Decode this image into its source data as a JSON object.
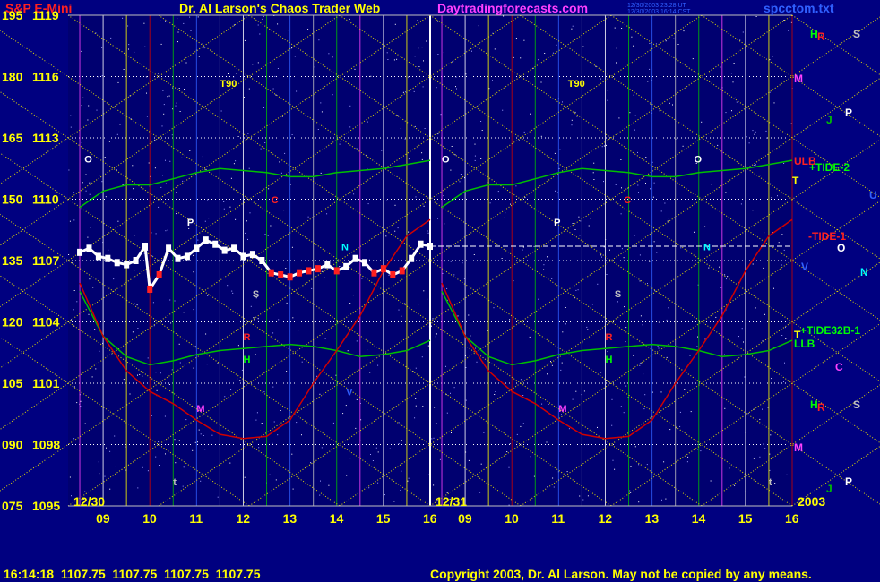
{
  "header": {
    "symbol": "S&P E-Mini",
    "title": "Dr. Al Larson's Chaos Trader Web",
    "site": "Daytradingforecasts.com",
    "stamp_line1": "12/30/2003 23:28 UT",
    "stamp_line2": "12/30/2003 16:14 CST",
    "file": "spcctom.txt"
  },
  "footer": {
    "quote": "16:14:18  1107.75  1107.75  1107.75  1107.75",
    "copyright": "Copyright 2003, Dr. Al Larson. May not be copied by any means."
  },
  "colors": {
    "background": "#000080",
    "plot_background": "#000070",
    "price_text": "#ffff00",
    "symbol_red": "#ff2020",
    "site_magenta": "#ff40ff",
    "file_blue": "#3060ff",
    "grid_yellow": "#e8e000",
    "tide_green": "#00c000",
    "tide_red": "#d00000"
  },
  "chart_data": {
    "type": "line",
    "title": "S&P E-Mini",
    "y_left_labels": [
      "195",
      "180",
      "165",
      "150",
      "135",
      "120",
      "105",
      "090",
      "075"
    ],
    "y_price_labels": [
      "1119",
      "1116",
      "1113",
      "1110",
      "1107",
      "1104",
      "1101",
      "1098",
      "1095"
    ],
    "ylim": [
      1095,
      1119
    ],
    "panels": [
      {
        "date_label": "12/30",
        "hours": [
          "09",
          "10",
          "11",
          "12",
          "13",
          "14",
          "15",
          "16"
        ]
      },
      {
        "date_label": "12/31",
        "hours": [
          "09",
          "10",
          "11",
          "12",
          "13",
          "14",
          "15",
          "16"
        ]
      }
    ],
    "year_label": "2003",
    "price_series": {
      "name": "price",
      "x_hours": [
        8.5,
        8.7,
        8.9,
        9.1,
        9.3,
        9.5,
        9.7,
        9.9,
        10.0,
        10.2,
        10.4,
        10.6,
        10.8,
        11.0,
        11.2,
        11.4,
        11.6,
        11.8,
        12.0,
        12.2,
        12.4,
        12.6,
        12.8,
        13.0,
        13.2,
        13.4,
        13.6,
        13.8,
        14.0,
        14.2,
        14.4,
        14.6,
        14.8,
        15.0,
        15.2,
        15.4,
        15.6,
        15.8,
        16.0
      ],
      "y": [
        1107.4,
        1107.6,
        1107.2,
        1107.1,
        1106.9,
        1106.8,
        1107.0,
        1107.7,
        1105.6,
        1106.3,
        1107.6,
        1107.1,
        1107.2,
        1107.6,
        1108.0,
        1107.8,
        1107.5,
        1107.6,
        1107.2,
        1107.3,
        1107.0,
        1106.4,
        1106.3,
        1106.2,
        1106.4,
        1106.5,
        1106.6,
        1106.8,
        1106.5,
        1106.7,
        1107.1,
        1106.9,
        1106.4,
        1106.6,
        1106.3,
        1106.5,
        1107.1,
        1107.8,
        1107.7
      ]
    },
    "tides": [
      {
        "name": "TIDE-2",
        "x_hours": [
          8.5,
          9.0,
          9.5,
          10.0,
          10.5,
          11.0,
          11.5,
          12.0,
          12.5,
          13.0,
          13.5,
          14.0,
          14.5,
          15.0,
          15.5,
          16.0
        ],
        "y": [
          1109.6,
          1110.4,
          1110.7,
          1110.7,
          1111.0,
          1111.3,
          1111.5,
          1111.4,
          1111.3,
          1111.1,
          1111.1,
          1111.3,
          1111.4,
          1111.5,
          1111.7,
          1111.9
        ]
      },
      {
        "name": "TIDE32B-1",
        "x_hours": [
          8.5,
          9.0,
          9.5,
          10.0,
          10.5,
          11.0,
          11.5,
          12.0,
          12.5,
          13.0,
          13.5,
          14.0,
          14.5,
          15.0,
          15.5,
          16.0
        ],
        "y": [
          1105.5,
          1103.3,
          1102.3,
          1101.9,
          1102.1,
          1102.4,
          1102.6,
          1102.7,
          1102.8,
          1102.9,
          1102.8,
          1102.6,
          1102.3,
          1102.4,
          1102.6,
          1103.1
        ]
      },
      {
        "name": "TIDE-1",
        "x_hours": [
          8.5,
          9.0,
          9.5,
          10.0,
          10.5,
          11.0,
          11.5,
          12.0,
          12.5,
          13.0,
          13.5,
          14.0,
          14.5,
          15.0,
          15.5,
          16.0
        ],
        "y": [
          1105.9,
          1103.3,
          1101.6,
          1100.6,
          1100.0,
          1099.2,
          1098.5,
          1098.3,
          1098.4,
          1099.2,
          1101.0,
          1102.6,
          1104.3,
          1106.5,
          1108.2,
          1109.0
        ]
      }
    ],
    "annotations_left": [
      {
        "text": "T90",
        "color": "#ffff00"
      },
      {
        "text": "O",
        "color": "#ffffff"
      },
      {
        "text": "P",
        "color": "#ffffff"
      },
      {
        "text": "C",
        "color": "#ff2020"
      },
      {
        "text": "N",
        "color": "#00ffff"
      },
      {
        "text": "S",
        "color": "#c0c0c0"
      },
      {
        "text": "R",
        "color": "#ff2020"
      },
      {
        "text": "H",
        "color": "#00ff00"
      },
      {
        "text": "M",
        "color": "#ff40ff"
      },
      {
        "text": "V",
        "color": "#3060ff"
      },
      {
        "text": "t",
        "color": "#c0c0c0"
      }
    ],
    "annotations_right_panel": [
      {
        "text": "T90",
        "color": "#ffff00"
      },
      {
        "text": "O",
        "color": "#ffffff"
      },
      {
        "text": "O",
        "color": "#ffffff"
      },
      {
        "text": "P",
        "color": "#ffffff"
      },
      {
        "text": "C",
        "color": "#ff2020"
      },
      {
        "text": "N",
        "color": "#00ffff"
      },
      {
        "text": "S",
        "color": "#c0c0c0"
      },
      {
        "text": "R",
        "color": "#ff2020"
      },
      {
        "text": "H",
        "color": "#00ff00"
      },
      {
        "text": "M",
        "color": "#ff40ff"
      },
      {
        "text": "t",
        "color": "#c0c0c0"
      }
    ],
    "right_legend": [
      {
        "text": "H",
        "color": "#00ff00"
      },
      {
        "text": "R",
        "color": "#ff2020"
      },
      {
        "text": "S",
        "color": "#c0c0c0"
      },
      {
        "text": "M",
        "color": "#ff40ff"
      },
      {
        "text": "J",
        "color": "#00c000"
      },
      {
        "text": "P",
        "color": "#ffffff"
      },
      {
        "text": "ULB",
        "color": "#ff2020"
      },
      {
        "text": "+TIDE-2",
        "color": "#00ff00"
      },
      {
        "text": "T",
        "color": "#ffff00"
      },
      {
        "text": "U",
        "color": "#3060ff"
      },
      {
        "text": "-TIDE-1",
        "color": "#ff2020"
      },
      {
        "text": "O",
        "color": "#ffffff"
      },
      {
        "text": "V",
        "color": "#3060ff"
      },
      {
        "text": "N",
        "color": "#00ffff"
      },
      {
        "text": "T",
        "color": "#ffff00"
      },
      {
        "text": "+TIDE32B-1",
        "color": "#00ff00"
      },
      {
        "text": "LLB",
        "color": "#00ff00"
      },
      {
        "text": "C",
        "color": "#ff40ff"
      },
      {
        "text": "H",
        "color": "#00ff00"
      },
      {
        "text": "R",
        "color": "#ff2020"
      },
      {
        "text": "S",
        "color": "#c0c0c0"
      },
      {
        "text": "M",
        "color": "#ff40ff"
      },
      {
        "text": "J",
        "color": "#00c000"
      },
      {
        "text": "P",
        "color": "#ffffff"
      }
    ],
    "grid": true
  }
}
